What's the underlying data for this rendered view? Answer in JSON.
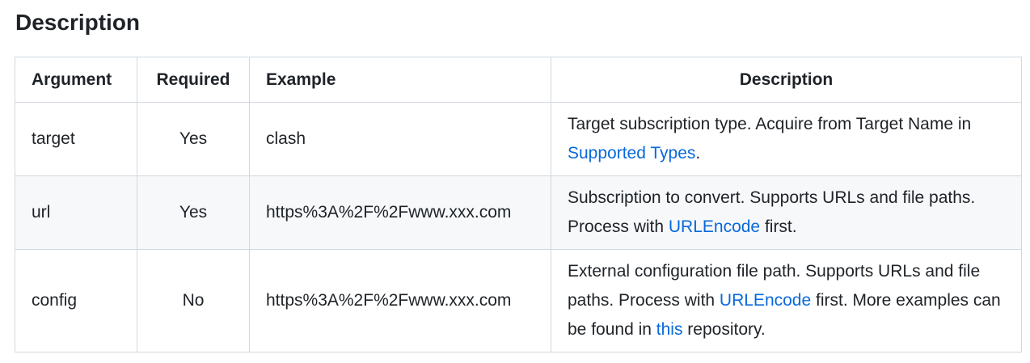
{
  "heading": "Description",
  "headers": [
    "Argument",
    "Required",
    "Example",
    "Description"
  ],
  "rows": [
    {
      "argument": "target",
      "required": "Yes",
      "example": "clash",
      "desc": [
        "Target subscription type. Acquire from Target Name in ",
        {
          "link": "Supported Types"
        },
        "."
      ]
    },
    {
      "argument": "url",
      "required": "Yes",
      "example": "https%3A%2F%2Fwww.xxx.com",
      "desc": [
        "Subscription to convert. Supports URLs and file paths. Process with ",
        {
          "link": "URLEncode"
        },
        " first."
      ]
    },
    {
      "argument": "config",
      "required": "No",
      "example": "https%3A%2F%2Fwww.xxx.com",
      "desc": [
        "External configuration file path. Supports URLs and file paths. Process with ",
        {
          "link": "URLEncode"
        },
        " first. More examples can be found in ",
        {
          "link": "this"
        },
        " repository."
      ]
    }
  ],
  "colors": {
    "link": "#0969da",
    "border": "#d1d9e0",
    "alt_row": "#f6f8fa"
  }
}
